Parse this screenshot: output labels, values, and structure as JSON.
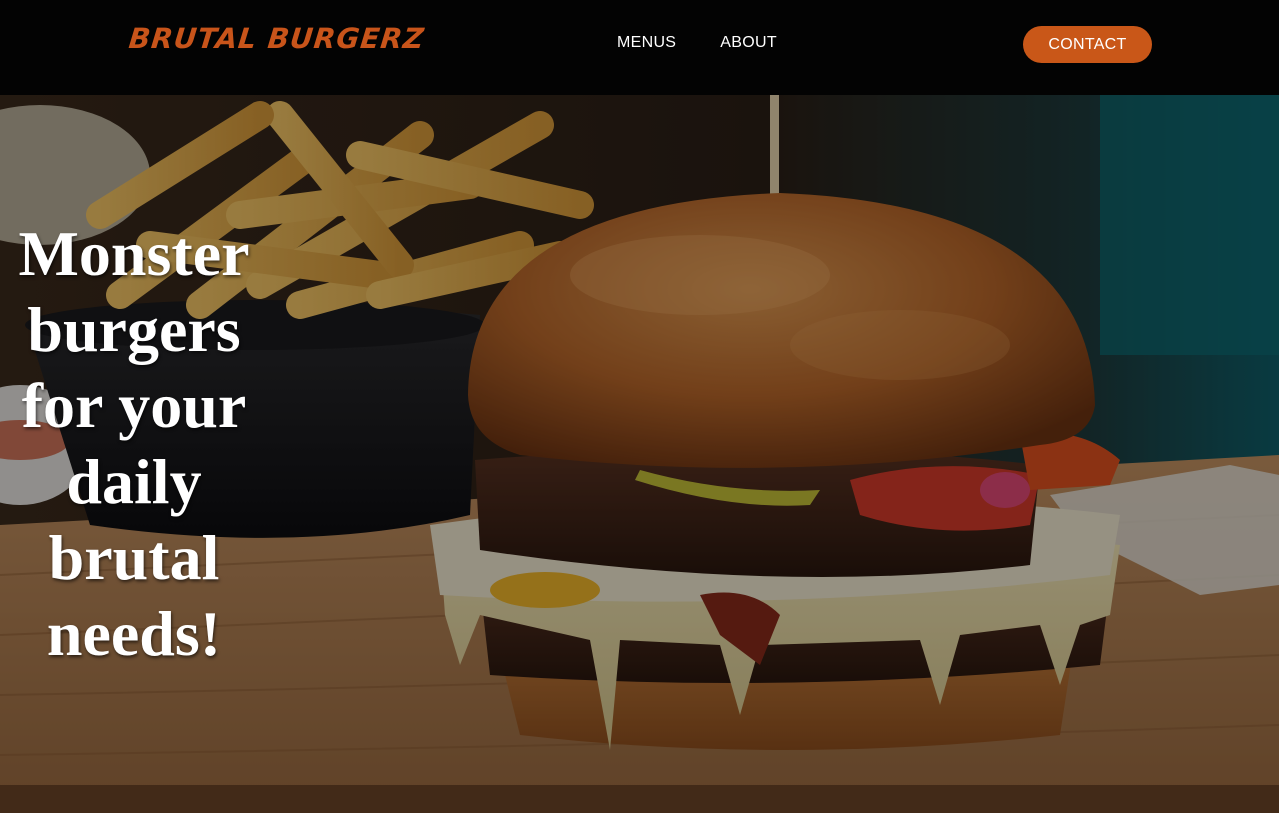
{
  "brand": {
    "logo_text": "BRUTAL BURGERZ",
    "accent_color": "#c95718"
  },
  "nav": {
    "items": [
      {
        "label": "MENUS"
      },
      {
        "label": "ABOUT"
      }
    ],
    "contact_label": "CONTACT"
  },
  "hero": {
    "headline": "Monster burgers for your daily brutal needs!",
    "background_image": "burger-with-fries-photo"
  }
}
